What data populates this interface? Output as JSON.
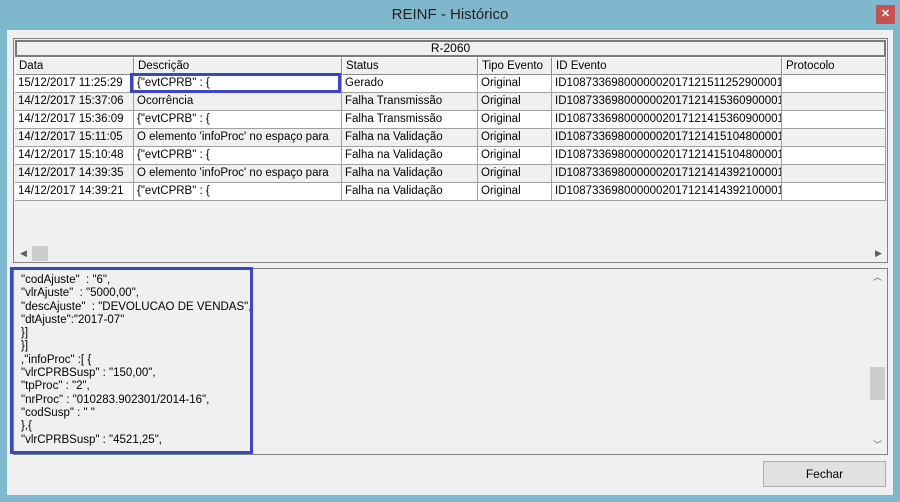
{
  "window": {
    "title": "REINF - Histórico",
    "close_icon": "close-icon"
  },
  "grid": {
    "band": "R-2060",
    "columns": [
      "Data",
      "Descrição",
      "Status",
      "Tipo Evento",
      "ID Evento",
      "Protocolo"
    ],
    "rows": [
      [
        "15/12/2017 11:25:29",
        "{\"evtCPRB\" : {",
        "Gerado",
        "Original",
        "ID1087336980000002017121511252900001",
        ""
      ],
      [
        "14/12/2017 15:37:06",
        "Ocorrência",
        "Falha Transmissão",
        "Original",
        "ID1087336980000002017121415360900001",
        ""
      ],
      [
        "14/12/2017 15:36:09",
        "{\"evtCPRB\" : {",
        "Falha Transmissão",
        "Original",
        "ID1087336980000002017121415360900001",
        ""
      ],
      [
        "14/12/2017 15:11:05",
        "O elemento 'infoProc' no espaço para",
        "Falha na Validação",
        "Original",
        "ID1087336980000002017121415104800001",
        ""
      ],
      [
        "14/12/2017 15:10:48",
        "{\"evtCPRB\" : {",
        "Falha na Validação",
        "Original",
        "ID1087336980000002017121415104800001",
        ""
      ],
      [
        "14/12/2017 14:39:35",
        "O elemento 'infoProc' no espaço para",
        "Falha na Validação",
        "Original",
        "ID1087336980000002017121414392100001",
        ""
      ],
      [
        "14/12/2017 14:39:21",
        "{\"evtCPRB\" : {",
        "Falha na Validação",
        "Original",
        "ID1087336980000002017121414392100001",
        ""
      ]
    ]
  },
  "detail": {
    "lines": [
      "\"codAjuste\"  : \"6\",",
      "\"vlrAjuste\"  : \"5000,00\",",
      "\"descAjuste\"  : \"DEVOLUCAO DE VENDAS\",",
      "\"dtAjuste\":\"2017-07\"",
      "}]",
      "}]",
      ",\"infoProc\" :[ {",
      "\"vlrCPRBSusp\" : \"150,00\",",
      "\"tpProc\" : \"2\",",
      "\"nrProc\" : \"010283.902301/2014-16\",",
      "\"codSusp\" : \" \"",
      "},{",
      "\"vlrCPRBSusp\" : \"4521,25\","
    ]
  },
  "buttons": {
    "close": "Fechar"
  }
}
